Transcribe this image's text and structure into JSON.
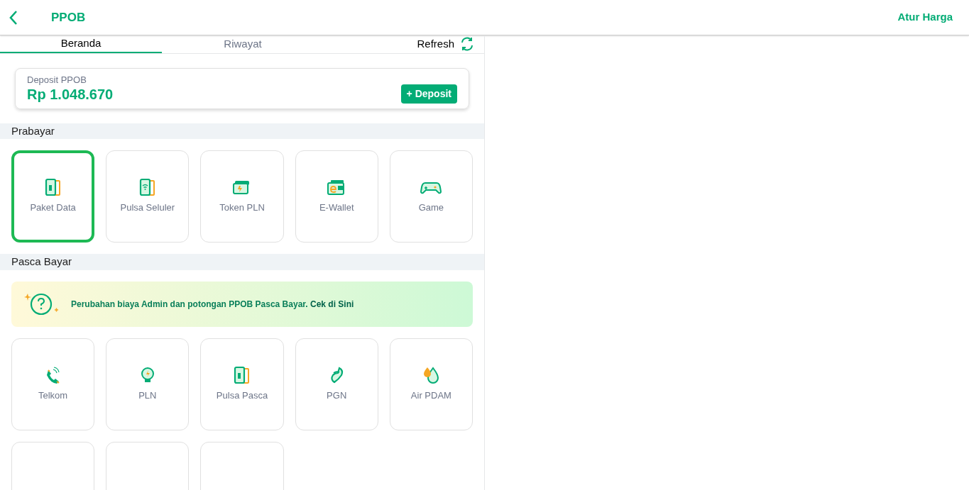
{
  "header": {
    "title": "PPOB",
    "action": "Atur Harga"
  },
  "tabs": [
    {
      "label": "Beranda",
      "selected": true
    },
    {
      "label": "Riwayat",
      "selected": false
    }
  ],
  "refresh": {
    "label": "Refresh"
  },
  "deposit": {
    "label": "Deposit PPOB",
    "amount": "Rp 1.048.670",
    "button": "+ Deposit"
  },
  "prabayar": {
    "title": "Prabayar",
    "items": [
      {
        "kind": "data",
        "label": "Paket Data",
        "selected": true
      },
      {
        "kind": "pulsa",
        "label": "Pulsa Seluler",
        "selected": false
      },
      {
        "kind": "token",
        "label": "Token PLN",
        "selected": false
      },
      {
        "kind": "ewallet",
        "label": "E-Wallet",
        "selected": false
      },
      {
        "kind": "game",
        "label": "Game",
        "selected": false
      }
    ]
  },
  "pascabayar": {
    "title": "Pasca Bayar",
    "notice": {
      "text": "Perubahan biaya Admin dan potongan PPOB Pasca Bayar.",
      "link": "Cek di Sini"
    },
    "items": [
      {
        "kind": "telkom",
        "label": "Telkom",
        "selected": false
      },
      {
        "kind": "pln",
        "label": "PLN",
        "selected": false
      },
      {
        "kind": "data",
        "label": "Pulsa Pasca",
        "selected": false
      },
      {
        "kind": "pgn",
        "label": "PGN",
        "selected": false
      },
      {
        "kind": "pdam",
        "label": "Air PDAM",
        "selected": false
      },
      {
        "kind": "cut",
        "selected": false
      },
      {
        "kind": "cut",
        "selected": false
      },
      {
        "kind": "cut",
        "selected": false
      }
    ]
  }
}
